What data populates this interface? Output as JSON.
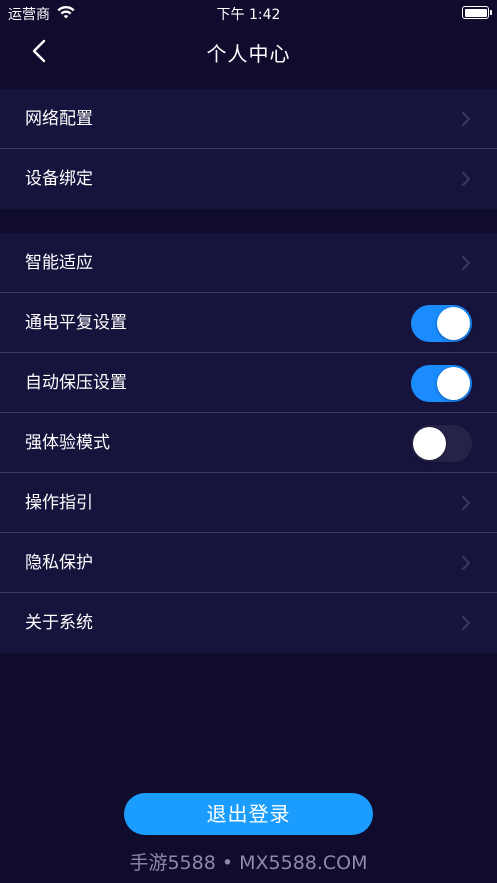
{
  "status_bar": {
    "carrier": "运营商",
    "time": "下午 1:42"
  },
  "nav": {
    "title": "个人中心"
  },
  "settings": {
    "group1": [
      {
        "label": "网络配置"
      },
      {
        "label": "设备绑定"
      }
    ],
    "group2": [
      {
        "label": "智能适应"
      },
      {
        "label": "通电平复设置",
        "toggle": true
      },
      {
        "label": "自动保压设置",
        "toggle": true
      },
      {
        "label": "强体验模式",
        "toggle": false
      },
      {
        "label": "操作指引"
      },
      {
        "label": "隐私保护"
      },
      {
        "label": "关于系统"
      }
    ]
  },
  "logout_label": "退出登录",
  "watermark": "手游5588 • MX5588.COM",
  "colors": {
    "background": "#0f0c2e",
    "row_background": "#16133d",
    "accent": "#1a9dff",
    "toggle_on": "#1a8cff",
    "toggle_off": "#262349"
  },
  "icons": [
    "back-arrow-icon",
    "chevron-right-icon",
    "wifi-icon",
    "battery-icon"
  ]
}
